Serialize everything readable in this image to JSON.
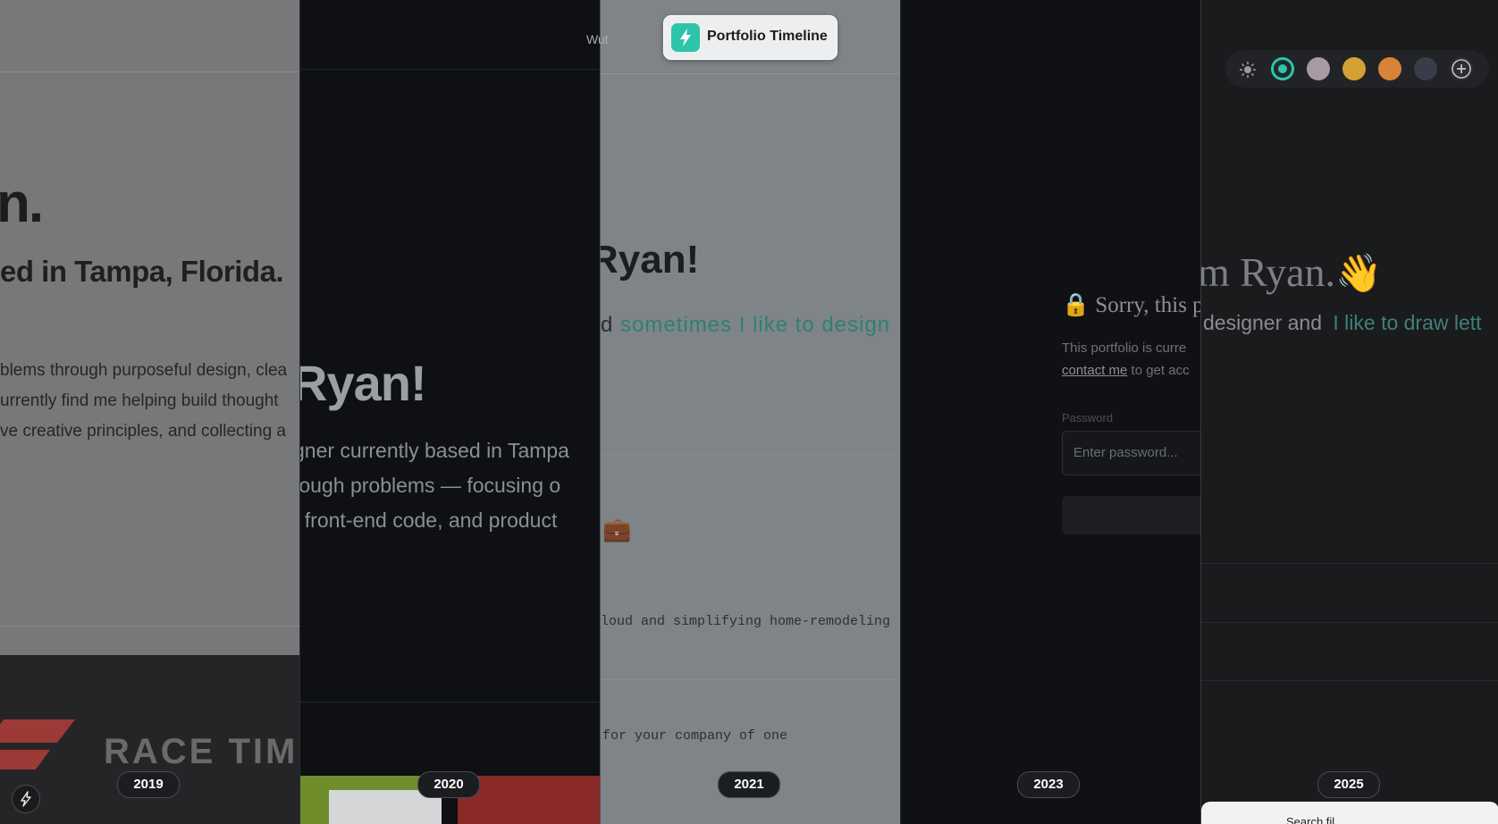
{
  "header": {
    "nav_text": "Wut",
    "badge_label": "Portfolio Timeline",
    "badge_icon": "lightning-bolt-icon",
    "badge_color": "#2ec4a9"
  },
  "p2019": {
    "hero_fragment": "n.",
    "subtitle": "ed in Tampa, Florida.",
    "body_lines": [
      "blems through purposeful design, clea",
      "urrently find me helping build thought",
      "ve creative principles, and collecting a"
    ],
    "project_banner": "RACE TIM"
  },
  "p2020": {
    "hero_fragment": "Ryan!",
    "body_lines": [
      "gner currently based in Tampa",
      "tough problems — focusing o",
      ", front-end code, and product"
    ]
  },
  "p2021": {
    "hero_fragment": "Ryan!",
    "subtitle_prefix": "d",
    "subtitle_accent": "sometimes I like to design",
    "emoji": "💼",
    "project_line_1": "loud and simplifying home-remodeling",
    "project_line_2": "for your company of one"
  },
  "p2023": {
    "lock_title": "🔒 Sorry, this p",
    "message_line_1": "This portfolio is curre",
    "contact_link": "contact me",
    "message_line_2_rest": " to get acc",
    "password_label": "Password",
    "password_placeholder": "Enter password..."
  },
  "p2025": {
    "hero_fragment": "m Ryan.",
    "wave_emoji": "👋",
    "subtitle_prefix": "designer and",
    "subtitle_accent": "I like to draw lett",
    "theme_colors": [
      "#2ec4a9",
      "#a79aa4",
      "#d2a334",
      "#d88337",
      "#3a3c4a"
    ],
    "bottom_card_text": "Search fil"
  },
  "years": [
    "2019",
    "2020",
    "2021",
    "2023",
    "2025"
  ],
  "corner_icon": "lightning-bolt-icon"
}
